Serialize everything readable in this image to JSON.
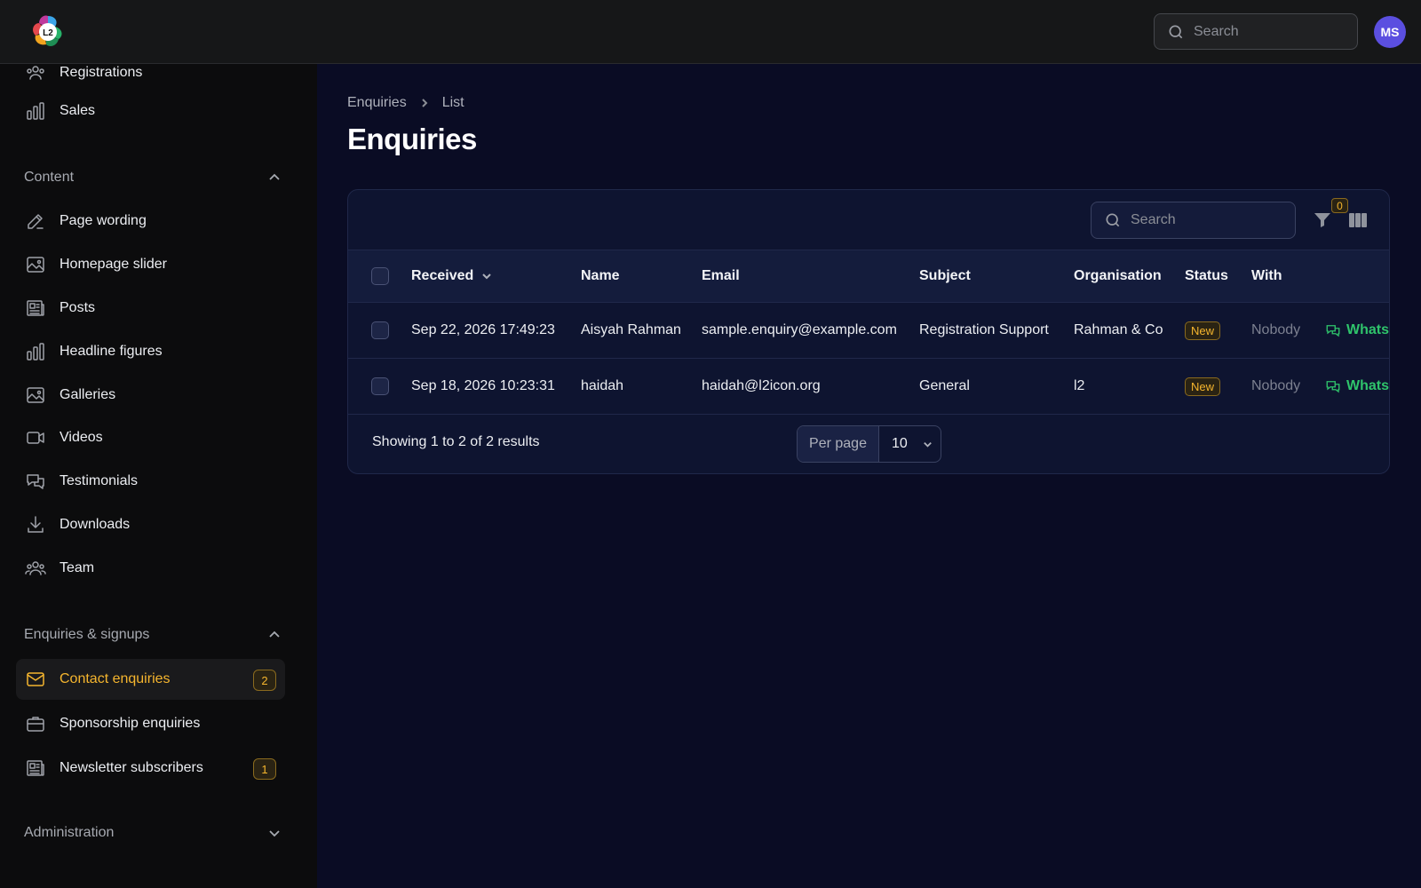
{
  "header": {
    "logo_text": "L2",
    "search_placeholder": "Search",
    "avatar_initials": "MS"
  },
  "sidebar": {
    "top_items": [
      {
        "label": "Registrations",
        "icon": "users-icon"
      },
      {
        "label": "Sales",
        "icon": "bar-chart-icon"
      }
    ],
    "groups": [
      {
        "title": "Content",
        "expanded": true,
        "items": [
          {
            "label": "Page wording",
            "icon": "pencil-square-icon"
          },
          {
            "label": "Homepage slider",
            "icon": "image-icon"
          },
          {
            "label": "Posts",
            "icon": "newspaper-icon"
          },
          {
            "label": "Headline figures",
            "icon": "bar-chart-icon"
          },
          {
            "label": "Galleries",
            "icon": "image-icon"
          },
          {
            "label": "Videos",
            "icon": "video-camera-icon"
          },
          {
            "label": "Testimonials",
            "icon": "chat-bubbles-icon"
          },
          {
            "label": "Downloads",
            "icon": "download-icon"
          },
          {
            "label": "Team",
            "icon": "users-icon"
          }
        ]
      },
      {
        "title": "Enquiries & signups",
        "expanded": true,
        "items": [
          {
            "label": "Contact enquiries",
            "icon": "envelope-icon",
            "badge": "2",
            "active": true
          },
          {
            "label": "Sponsorship enquiries",
            "icon": "briefcase-icon"
          },
          {
            "label": "Newsletter subscribers",
            "icon": "newspaper-icon",
            "badge": "1"
          }
        ]
      },
      {
        "title": "Administration",
        "expanded": false,
        "items": []
      }
    ]
  },
  "breadcrumb": [
    "Enquiries",
    "List"
  ],
  "page_title": "Enquiries",
  "table": {
    "search_placeholder": "Search",
    "filter_count": "0",
    "columns": [
      "Received",
      "Name",
      "Email",
      "Subject",
      "Organisation",
      "Status",
      "With"
    ],
    "rows": [
      {
        "received": "Sep 22, 2026 17:49:23",
        "name": "Aisyah Rahman",
        "email": "sample.enquiry@example.com",
        "subject": "Registration Support",
        "organisation": "Rahman & Co",
        "status": "New",
        "with": "Nobody",
        "action": "WhatsA"
      },
      {
        "received": "Sep 18, 2026 10:23:31",
        "name": "haidah",
        "email": "haidah@l2icon.org",
        "subject": "General",
        "organisation": "l2",
        "status": "New",
        "with": "Nobody",
        "action": "WhatsA"
      }
    ],
    "summary": "Showing 1 to 2 of 2 results",
    "per_page_label": "Per page",
    "per_page_value": "10"
  },
  "colors": {
    "accent": "#f5b52e",
    "whatsapp": "#2fc46b",
    "avatar": "#5b4fe0",
    "background": "#0a0c24"
  }
}
